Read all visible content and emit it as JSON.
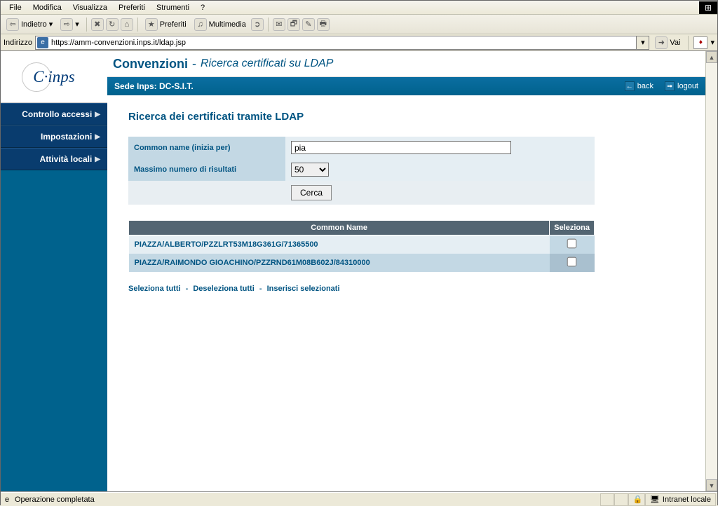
{
  "menubar": {
    "items": [
      "File",
      "Modifica",
      "Visualizza",
      "Preferiti",
      "Strumenti",
      "?"
    ]
  },
  "toolbar": {
    "back_label": "Indietro",
    "fav_label": "Preferiti",
    "media_label": "Multimedia"
  },
  "address": {
    "label": "Indirizzo",
    "value": "https://amm-convenzioni.inps.it/ldap.jsp",
    "go_label": "Vai"
  },
  "logo_text": "C·inps",
  "sidebar": {
    "items": [
      {
        "label": "Controllo accessi"
      },
      {
        "label": "Impostazioni"
      },
      {
        "label": "Attività locali"
      }
    ]
  },
  "header": {
    "title": "Convenzioni",
    "subtitle": "Ricerca certificati su LDAP"
  },
  "sede": {
    "label": "Sede Inps: DC-S.I.T.",
    "back": "back",
    "logout": "logout"
  },
  "form": {
    "heading": "Ricerca dei certificati tramite LDAP",
    "common_name_label": "Common name (inizia per)",
    "common_name_value": "pia",
    "max_results_label": "Massimo numero di risultati",
    "max_results_value": "50",
    "max_results_options": [
      "50"
    ],
    "search_btn": "Cerca"
  },
  "results": {
    "col_name": "Common Name",
    "col_select": "Seleziona",
    "rows": [
      {
        "name": "PIAZZA/ALBERTO/PZZLRT53M18G361G/71365500"
      },
      {
        "name": "PIAZZA/RAIMONDO GIOACHINO/PZZRND61M08B602J/84310000"
      }
    ]
  },
  "bulk_actions": {
    "select_all": "Seleziona tutti",
    "deselect_all": "Deseleziona tutti",
    "insert_selected": "Inserisci selezionati"
  },
  "statusbar": {
    "text": "Operazione completata",
    "zone": "Intranet locale"
  }
}
